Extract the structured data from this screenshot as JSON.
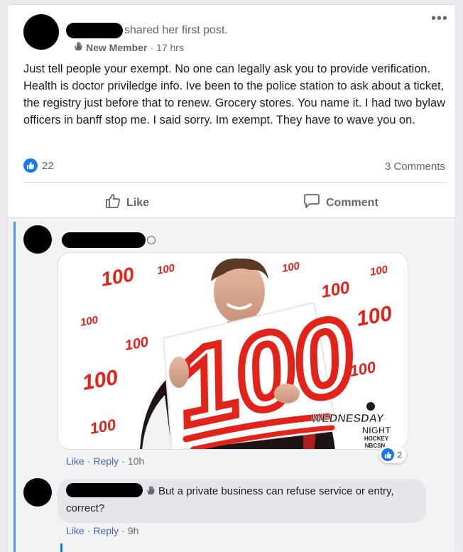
{
  "post": {
    "header_suffix": "shared her first post.",
    "badge": "New Member",
    "time": "17 hrs",
    "more_label": "•••",
    "text": "Just tell people your exempt. No one can legally ask you to provide verification. Health is doctor priviledge info. Ive been to the police station to ask about a ticket, the registry just before that to renew. Grocery stores. You name it. I had two bylaw officers in banff stop me. I said sorry. Im exempt. They have to wave you on.",
    "reaction_count": "22",
    "comments_count": "3 Comments"
  },
  "actions": {
    "like": "Like",
    "comment": "Comment"
  },
  "comment1": {
    "gif": {
      "big_text": "100",
      "small_emoji": "100",
      "watermark": [
        "WEDNESDAY",
        "NIGHT",
        "HOCKEY",
        "NBCSN"
      ]
    },
    "like": "Like",
    "reply": "Reply",
    "time": "10h",
    "reactions": "2"
  },
  "comment2": {
    "text": "But a private business can refuse service or entry, correct?",
    "like": "Like",
    "reply": "Reply",
    "time": "9h"
  },
  "colors": {
    "accent": "#1877f2",
    "emoji_red": "#e2231a"
  }
}
